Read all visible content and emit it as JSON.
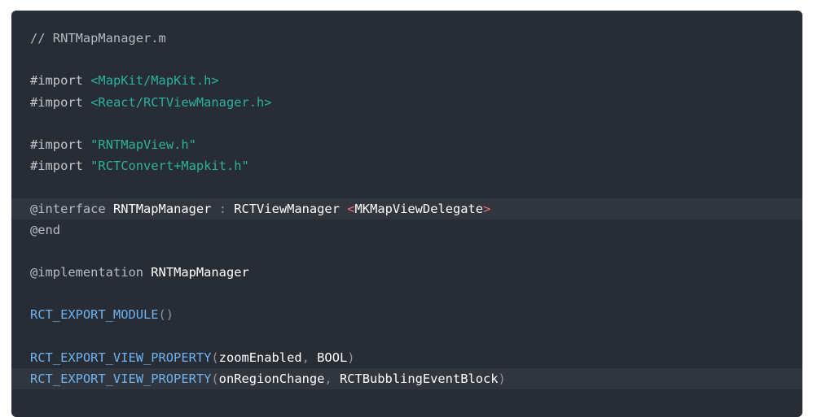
{
  "code": {
    "comment": "// RNTMapManager.m",
    "import_kw": "#import",
    "import_mapkit": "<MapKit/MapKit.h>",
    "import_react": "<React/RCTViewManager.h>",
    "import_mapview": "\"RNTMapView.h\"",
    "import_convert": "\"RCTConvert+Mapkit.h\"",
    "interface_kw": "@interface",
    "class_name": "RNTMapManager",
    "colon": " : ",
    "super_class": "RCTViewManager",
    "protocol_open": "<",
    "protocol": "MKMapViewDelegate",
    "protocol_close": ">",
    "end_kw": "@end",
    "implementation_kw": "@implementation",
    "export_module": "RCT_EXPORT_MODULE",
    "empty_parens": "()",
    "export_prop": "RCT_EXPORT_VIEW_PROPERTY",
    "lparen": "(",
    "rparen": ")",
    "comma": ", ",
    "prop1_name": "zoomEnabled",
    "prop1_type": "BOOL",
    "prop2_name": "onRegionChange",
    "prop2_type": "RCTBubblingEventBlock"
  },
  "colors": {
    "background": "#282c34",
    "highlight_line": "#31353d",
    "string": "#2bb398",
    "macro": "#6db3f2",
    "angle": "#ef6e7c"
  }
}
